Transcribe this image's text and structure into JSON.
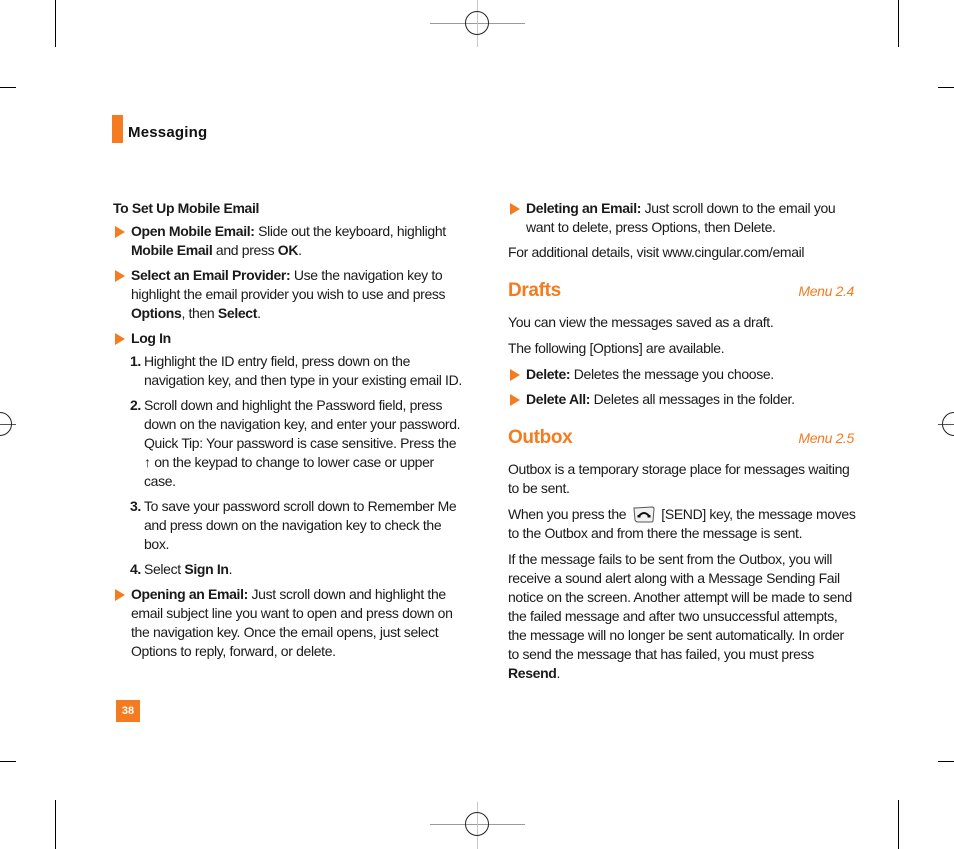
{
  "header": {
    "section_title": "Messaging",
    "accent_color": "#f47b20"
  },
  "page_number": "38",
  "left_column": {
    "heading": "To Set Up Mobile Email",
    "open_email": {
      "label": "Open Mobile Email:",
      "text1": " Slide out the keyboard, highlight ",
      "bold1": "Mobile Email",
      "text2": " and press ",
      "bold2": "OK",
      "text3": "."
    },
    "select_provider": {
      "label": "Select an Email Provider:",
      "text1": " Use the navigation key to highlight the email provider you wish to use and press ",
      "bold1": "Options",
      "text2": ", then ",
      "bold2": "Select",
      "text3": "."
    },
    "log_in": {
      "label": "Log In",
      "steps": [
        {
          "num": "1.",
          "text": "Highlight the ID entry field, press down on the navigation key, and then type in your existing email ID."
        },
        {
          "num": "2.",
          "text": "Scroll down and highlight the Password field, press down on the navigation key, and enter your password.",
          "tip_before": "Quick Tip: Your password is case sensitive. Press the ",
          "tip_symbol": "↑",
          "tip_after": " on the keypad to change to lower case or upper case."
        },
        {
          "num": "3.",
          "text": "To save your password scroll down to Remember Me and press down on the navigation key to check the box."
        },
        {
          "num": "4.",
          "text_before": "Select ",
          "bold": "Sign In",
          "text_after": "."
        }
      ]
    },
    "opening_email": {
      "label": "Opening an Email:",
      "text": " Just scroll down and highlight the email subject line you want to open and press down on the navigation key. Once the email opens, just select Options to reply, forward, or delete."
    }
  },
  "right_column": {
    "deleting_email": {
      "label": "Deleting an Email:",
      "text": " Just scroll down to the email you want to delete, press Options, then Delete."
    },
    "additional_details": "For additional details, visit www.cingular.com/email",
    "drafts": {
      "title": "Drafts",
      "menu": "Menu 2.4",
      "intro": "You can view the messages saved as a draft.",
      "options_intro": "The following [Options] are available.",
      "options": [
        {
          "label": "Delete:",
          "text": " Deletes the message you choose."
        },
        {
          "label": "Delete All:",
          "text": " Deletes all messages in the folder."
        }
      ]
    },
    "outbox": {
      "title": "Outbox",
      "menu": "Menu 2.5",
      "intro": "Outbox is a temporary storage place for messages waiting to be sent.",
      "send_before": "When you press the ",
      "send_icon": "send-key-icon",
      "send_after": " [SEND] key, the message moves to the Outbox and from there the message is sent.",
      "fail_text": "If the message fails to be sent from the Outbox, you will receive a sound alert along with a Message Sending Fail notice on the screen. Another attempt will be made to send the failed message and after two unsuccessful attempts, the message will no longer be sent automatically. In order to send the message that has failed, you must press ",
      "fail_bold": "Resend",
      "fail_end": "."
    }
  }
}
